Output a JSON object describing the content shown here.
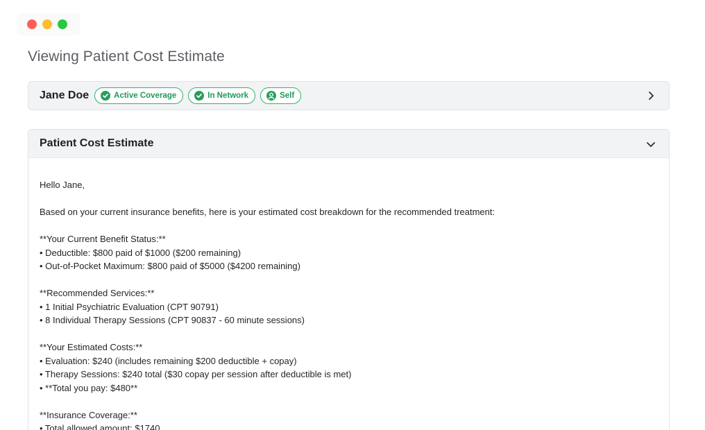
{
  "window": {
    "controls": [
      {
        "name": "close",
        "color": "#ff5f57"
      },
      {
        "name": "minimize",
        "color": "#febc2e"
      },
      {
        "name": "maximize",
        "color": "#28c840"
      }
    ]
  },
  "page": {
    "title": "Viewing Patient Cost Estimate"
  },
  "patient": {
    "name": "Jane Doe",
    "badges": [
      {
        "label": "Active Coverage",
        "icon": "check-circle-icon"
      },
      {
        "label": "In Network",
        "icon": "check-circle-icon"
      },
      {
        "label": "Self",
        "icon": "person-circle-icon"
      }
    ],
    "accent_color": "#2fb36a"
  },
  "estimate": {
    "title": "Patient Cost Estimate",
    "greeting": "Hello Jane,",
    "intro": "Based on your current insurance benefits, here is your estimated cost breakdown for the recommended treatment:",
    "benefit_status": {
      "heading": "**Your Current Benefit Status:**",
      "items": [
        "• Deductible: $800 paid of $1000 ($200 remaining)",
        "• Out-of-Pocket Maximum: $800 paid of $5000 ($4200 remaining)"
      ]
    },
    "services": {
      "heading": "**Recommended Services:**",
      "items": [
        "• 1 Initial Psychiatric Evaluation (CPT 90791)",
        "• 8 Individual Therapy Sessions (CPT 90837 - 60 minute sessions)"
      ]
    },
    "costs": {
      "heading": "**Your Estimated Costs:**",
      "items": [
        "• Evaluation: $240 (includes remaining $200 deductible + copay)",
        "• Therapy Sessions: $240 total ($30 copay per session after deductible is met)",
        "• **Total you pay: $480**"
      ]
    },
    "coverage": {
      "heading": "**Insurance Coverage:**",
      "items": [
        "• Total allowed amount: $1740"
      ]
    }
  }
}
